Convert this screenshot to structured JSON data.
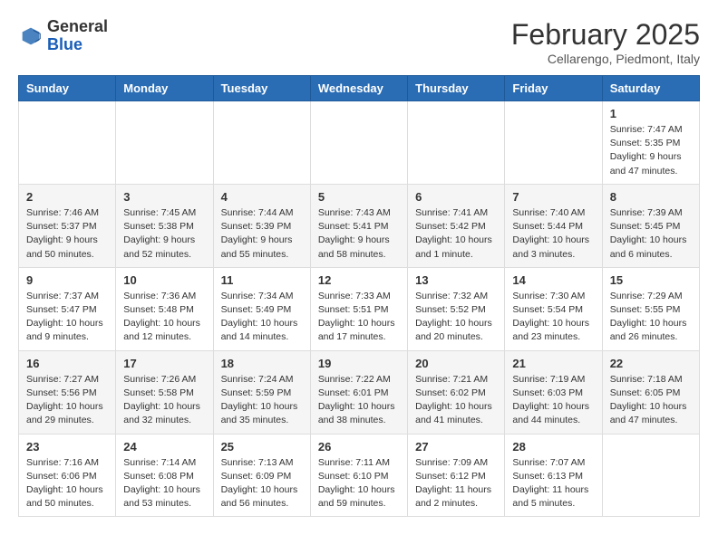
{
  "logo": {
    "general": "General",
    "blue": "Blue"
  },
  "header": {
    "month": "February 2025",
    "location": "Cellarengo, Piedmont, Italy"
  },
  "weekdays": [
    "Sunday",
    "Monday",
    "Tuesday",
    "Wednesday",
    "Thursday",
    "Friday",
    "Saturday"
  ],
  "weeks": [
    [
      null,
      null,
      null,
      null,
      null,
      null,
      {
        "day": "1",
        "sunrise": "7:47 AM",
        "sunset": "5:35 PM",
        "daylight": "9 hours and 47 minutes."
      }
    ],
    [
      {
        "day": "2",
        "sunrise": "7:46 AM",
        "sunset": "5:37 PM",
        "daylight": "9 hours and 50 minutes."
      },
      {
        "day": "3",
        "sunrise": "7:45 AM",
        "sunset": "5:38 PM",
        "daylight": "9 hours and 52 minutes."
      },
      {
        "day": "4",
        "sunrise": "7:44 AM",
        "sunset": "5:39 PM",
        "daylight": "9 hours and 55 minutes."
      },
      {
        "day": "5",
        "sunrise": "7:43 AM",
        "sunset": "5:41 PM",
        "daylight": "9 hours and 58 minutes."
      },
      {
        "day": "6",
        "sunrise": "7:41 AM",
        "sunset": "5:42 PM",
        "daylight": "10 hours and 1 minute."
      },
      {
        "day": "7",
        "sunrise": "7:40 AM",
        "sunset": "5:44 PM",
        "daylight": "10 hours and 3 minutes."
      },
      {
        "day": "8",
        "sunrise": "7:39 AM",
        "sunset": "5:45 PM",
        "daylight": "10 hours and 6 minutes."
      }
    ],
    [
      {
        "day": "9",
        "sunrise": "7:37 AM",
        "sunset": "5:47 PM",
        "daylight": "10 hours and 9 minutes."
      },
      {
        "day": "10",
        "sunrise": "7:36 AM",
        "sunset": "5:48 PM",
        "daylight": "10 hours and 12 minutes."
      },
      {
        "day": "11",
        "sunrise": "7:34 AM",
        "sunset": "5:49 PM",
        "daylight": "10 hours and 14 minutes."
      },
      {
        "day": "12",
        "sunrise": "7:33 AM",
        "sunset": "5:51 PM",
        "daylight": "10 hours and 17 minutes."
      },
      {
        "day": "13",
        "sunrise": "7:32 AM",
        "sunset": "5:52 PM",
        "daylight": "10 hours and 20 minutes."
      },
      {
        "day": "14",
        "sunrise": "7:30 AM",
        "sunset": "5:54 PM",
        "daylight": "10 hours and 23 minutes."
      },
      {
        "day": "15",
        "sunrise": "7:29 AM",
        "sunset": "5:55 PM",
        "daylight": "10 hours and 26 minutes."
      }
    ],
    [
      {
        "day": "16",
        "sunrise": "7:27 AM",
        "sunset": "5:56 PM",
        "daylight": "10 hours and 29 minutes."
      },
      {
        "day": "17",
        "sunrise": "7:26 AM",
        "sunset": "5:58 PM",
        "daylight": "10 hours and 32 minutes."
      },
      {
        "day": "18",
        "sunrise": "7:24 AM",
        "sunset": "5:59 PM",
        "daylight": "10 hours and 35 minutes."
      },
      {
        "day": "19",
        "sunrise": "7:22 AM",
        "sunset": "6:01 PM",
        "daylight": "10 hours and 38 minutes."
      },
      {
        "day": "20",
        "sunrise": "7:21 AM",
        "sunset": "6:02 PM",
        "daylight": "10 hours and 41 minutes."
      },
      {
        "day": "21",
        "sunrise": "7:19 AM",
        "sunset": "6:03 PM",
        "daylight": "10 hours and 44 minutes."
      },
      {
        "day": "22",
        "sunrise": "7:18 AM",
        "sunset": "6:05 PM",
        "daylight": "10 hours and 47 minutes."
      }
    ],
    [
      {
        "day": "23",
        "sunrise": "7:16 AM",
        "sunset": "6:06 PM",
        "daylight": "10 hours and 50 minutes."
      },
      {
        "day": "24",
        "sunrise": "7:14 AM",
        "sunset": "6:08 PM",
        "daylight": "10 hours and 53 minutes."
      },
      {
        "day": "25",
        "sunrise": "7:13 AM",
        "sunset": "6:09 PM",
        "daylight": "10 hours and 56 minutes."
      },
      {
        "day": "26",
        "sunrise": "7:11 AM",
        "sunset": "6:10 PM",
        "daylight": "10 hours and 59 minutes."
      },
      {
        "day": "27",
        "sunrise": "7:09 AM",
        "sunset": "6:12 PM",
        "daylight": "11 hours and 2 minutes."
      },
      {
        "day": "28",
        "sunrise": "7:07 AM",
        "sunset": "6:13 PM",
        "daylight": "11 hours and 5 minutes."
      },
      null
    ]
  ]
}
